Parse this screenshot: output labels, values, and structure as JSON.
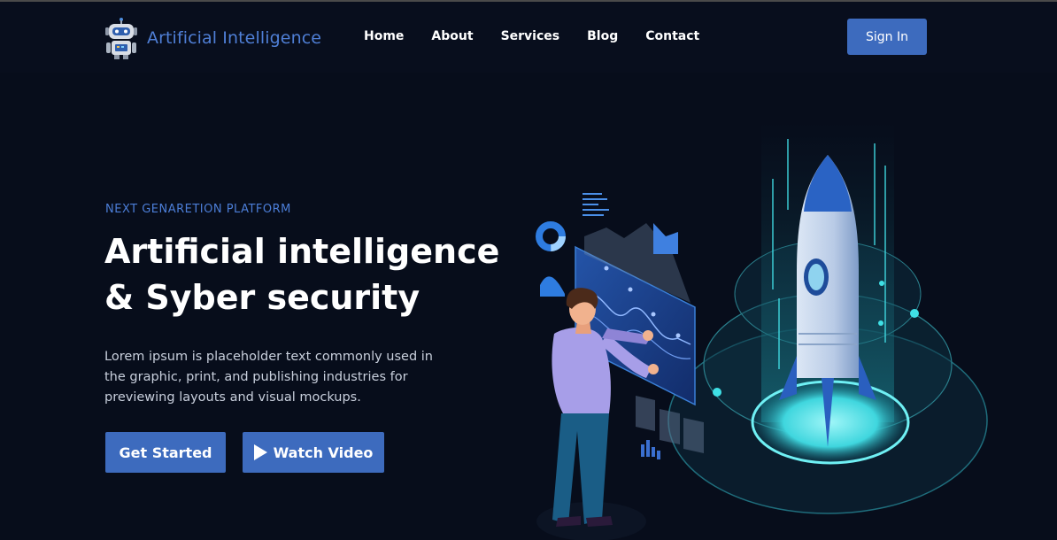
{
  "brand": {
    "name": "Artificial Intelligence",
    "logo_icon": "robot-icon"
  },
  "nav": {
    "links": [
      "Home",
      "About",
      "Services",
      "Blog",
      "Contact"
    ]
  },
  "signin_label": "Sign In",
  "hero": {
    "eyebrow": "NEXT GENARETION PLATFORM",
    "title_line1": "Artificial intelligence",
    "title_line2": "& Syber security",
    "description": "Lorem ipsum is placeholder text commonly used in the graphic, print, and publishing industries for previewing layouts and visual mockups.",
    "primary_button": "Get Started",
    "secondary_button": "Watch Video",
    "secondary_icon": "play-icon"
  },
  "colors": {
    "background": "#070d1b",
    "accent": "#3d6bbe",
    "accent_text": "#4f7fd6",
    "cyan_glow": "#3fe0e6"
  },
  "illustration": {
    "icon": "rocket-icon",
    "subject": "person-analytics-illustration"
  }
}
